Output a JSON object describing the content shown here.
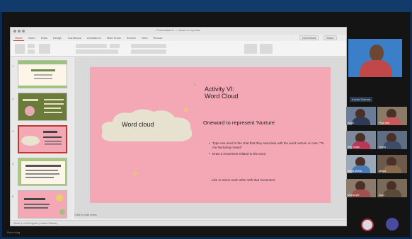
{
  "app": {
    "window_title": "Presentation1 — Saved to my Mac",
    "tabs": [
      "Home",
      "Insert",
      "Draw",
      "Design",
      "Transitions",
      "Animations",
      "Slide Show",
      "Review",
      "View",
      "Record"
    ],
    "active_tab": "Home",
    "ribbon_buttons": [
      "Comments",
      "Share"
    ]
  },
  "thumbnails": [
    {
      "number": "1"
    },
    {
      "number": "2"
    },
    {
      "number": "3"
    },
    {
      "number": "4"
    },
    {
      "number": "5"
    }
  ],
  "slide": {
    "cloud_text": "Word cloud",
    "activity_title_line1": "Activity VI:",
    "activity_title_line2": "Word Cloud",
    "heading": "Oneword to represent 'Nurture",
    "bullets": [
      "Type one word in the chat that they associate with the word nurture or care. \"To me Nurturing means\"",
      "Draw a movement related to the word"
    ],
    "like_line": "Like or mirror each other with that movement"
  },
  "notes_placeholder": "Click to add notes",
  "status_bar": "Slide 3 of 5   English (United States)",
  "video": {
    "speaker_name": "Kavita Sharma",
    "participants": [
      {
        "name": "Anjali"
      },
      {
        "name": "Priya Nair"
      },
      {
        "name": "Ritu Gupta"
      },
      {
        "name": "Sneha"
      },
      {
        "name": "Rahul Mehta"
      },
      {
        "name": "Deepa"
      },
      {
        "name": "Meera Iyer"
      },
      {
        "name": "Arjun"
      }
    ]
  },
  "footer_text": "Recording",
  "colors": {
    "background": "#0d2b52",
    "slide_pink": "#f4a8b6",
    "thumb_green": "#6b7b3a",
    "accent_red": "#c0392b"
  }
}
